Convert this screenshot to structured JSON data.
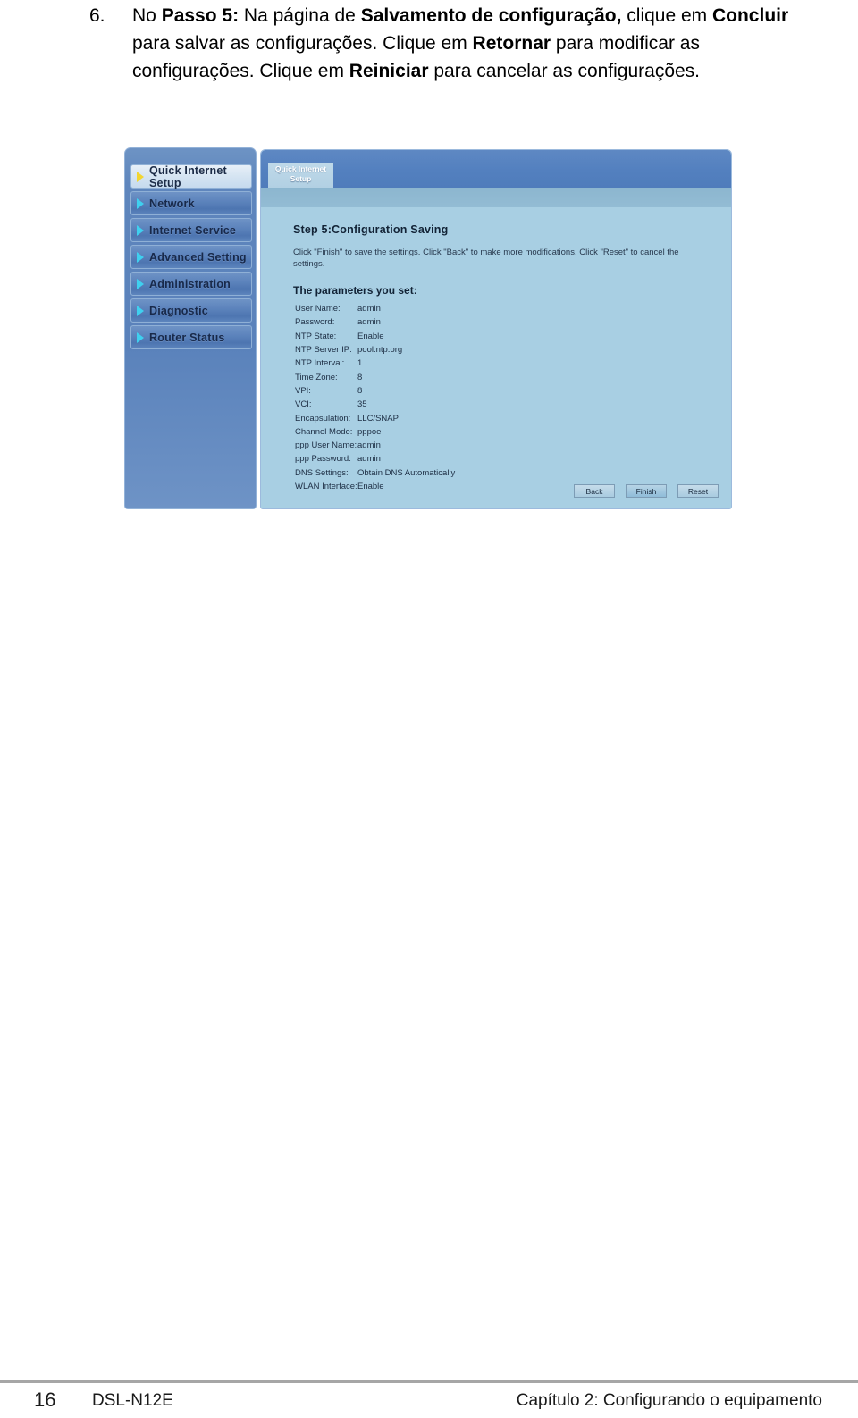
{
  "instruction": {
    "number": "6.",
    "segments": [
      {
        "text": "No ",
        "bold": false
      },
      {
        "text": "Passo 5:",
        "bold": true
      },
      {
        "text": " Na página de ",
        "bold": false
      },
      {
        "text": "Salvamento de configuração,",
        "bold": true
      },
      {
        "text": " clique em ",
        "bold": false
      },
      {
        "text": "Concluir",
        "bold": true
      },
      {
        "text": " para salvar as configurações. Clique em ",
        "bold": false
      },
      {
        "text": "Retornar",
        "bold": true
      },
      {
        "text": " para modificar as configurações. Clique em ",
        "bold": false
      },
      {
        "text": "Reiniciar",
        "bold": true
      },
      {
        "text": " para cancelar as configurações.",
        "bold": false
      }
    ]
  },
  "router_ui": {
    "sidebar": {
      "items": [
        {
          "label": "Quick Internet Setup",
          "active": true,
          "arrow_color": "#f2d531"
        },
        {
          "label": "Network",
          "active": false,
          "arrow_color": "#3fd0ef"
        },
        {
          "label": "Internet Service",
          "active": false,
          "arrow_color": "#3fd0ef"
        },
        {
          "label": "Advanced Setting",
          "active": false,
          "arrow_color": "#3fd0ef"
        },
        {
          "label": "Administration",
          "active": false,
          "arrow_color": "#3fd0ef"
        },
        {
          "label": "Diagnostic",
          "active": false,
          "arrow_color": "#3fd0ef"
        },
        {
          "label": "Router Status",
          "active": false,
          "arrow_color": "#3fd0ef"
        }
      ]
    },
    "tab": {
      "line1": "Quick Internet",
      "line2": "Setup"
    },
    "content": {
      "step_title": "Step 5:Configuration Saving",
      "description": "Click \"Finish\" to save the settings. Click \"Back\" to make more modifications. Click \"Reset\" to cancel the settings.",
      "params_title": "The parameters you set:",
      "params": [
        {
          "label": "User Name:",
          "value": "admin"
        },
        {
          "label": "Password:",
          "value": "admin"
        },
        {
          "label": "NTP State:",
          "value": "Enable"
        },
        {
          "label": "NTP Server IP:",
          "value": "pool.ntp.org"
        },
        {
          "label": "NTP Interval:",
          "value": "1"
        },
        {
          "label": "Time Zone:",
          "value": "8"
        },
        {
          "label": "VPI:",
          "value": "8"
        },
        {
          "label": "VCI:",
          "value": "35"
        },
        {
          "label": "Encapsulation:",
          "value": "LLC/SNAP"
        },
        {
          "label": "Channel Mode:",
          "value": "pppoe"
        },
        {
          "label": "ppp User Name:",
          "value": "admin"
        },
        {
          "label": "ppp Password:",
          "value": "admin"
        },
        {
          "label": "DNS Settings:",
          "value": "Obtain DNS Automatically"
        },
        {
          "label": "WLAN Interface:",
          "value": "Enable"
        }
      ],
      "buttons": [
        {
          "label": "Back",
          "primary": false
        },
        {
          "label": "Finish",
          "primary": true
        },
        {
          "label": "Reset",
          "primary": false
        }
      ]
    },
    "colors": {
      "panel_body": "#a8cfe3",
      "topbar": "#5380bf",
      "sidebar": "#5a82bb",
      "active_item": "#d5e4f2"
    }
  },
  "footer": {
    "page_number": "16",
    "model": "DSL-N12E",
    "chapter": "Capítulo 2: Configurando o equipamento"
  }
}
